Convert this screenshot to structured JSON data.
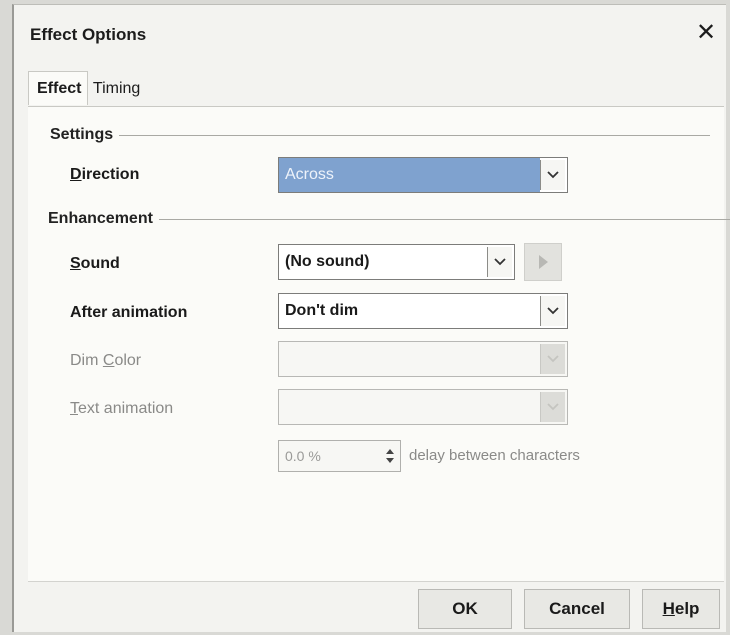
{
  "window": {
    "title": "Effect Options"
  },
  "tabs": [
    {
      "label": "Effect",
      "active": true
    },
    {
      "label": "Timing",
      "active": false
    }
  ],
  "settings": {
    "section_label": "Settings",
    "direction": {
      "label_prefix": "",
      "label_mnemonic": "D",
      "label_rest": "irection",
      "value": "Across"
    }
  },
  "enhancement": {
    "section_label": "Enhancement",
    "sound": {
      "label_mnemonic": "S",
      "label_rest": "ound",
      "value": "(No sound)"
    },
    "after_animation": {
      "label": "After animation",
      "value": "Don't dim"
    },
    "dim_color": {
      "label_prefix": "Dim ",
      "label_mnemonic": "C",
      "label_rest": "olor",
      "value": ""
    },
    "text_animation": {
      "label_mnemonic": "T",
      "label_rest": "ext animation",
      "value": ""
    },
    "delay": {
      "value": "0.0 %",
      "suffix": "delay between characters"
    }
  },
  "buttons": {
    "ok": "OK",
    "cancel": "Cancel",
    "help_mnemonic": "H",
    "help_rest": "elp"
  },
  "colors": {
    "selection": "#7fa2cf",
    "dialog_bg": "#f3f3f0",
    "panel_bg": "#fbfbf8"
  }
}
